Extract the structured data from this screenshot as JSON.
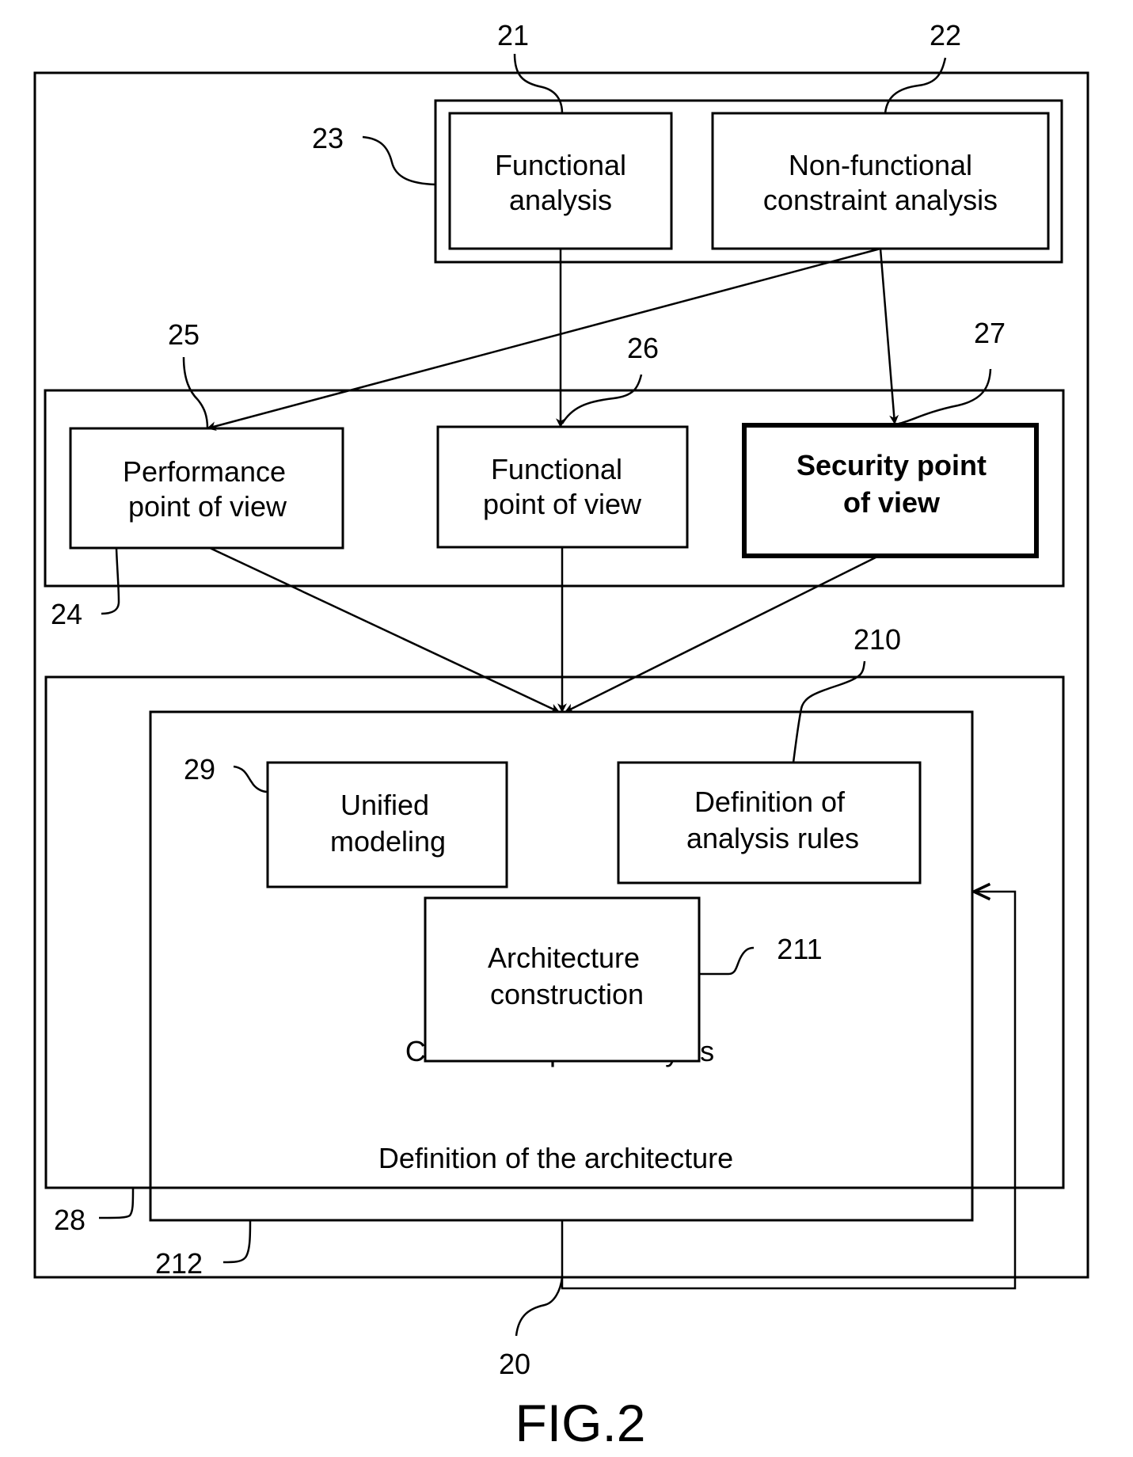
{
  "figure": {
    "caption": "FIG.2",
    "reference": "20"
  },
  "groups": {
    "analysis": {
      "ref": "23"
    },
    "points_of_view": {
      "ref": "24"
    },
    "architecture_definition": {
      "ref": "28",
      "label": "Definition of the architecture"
    },
    "crossed_impact": {
      "ref": "212",
      "label": "Crossed impact analysis"
    }
  },
  "boxes": {
    "functional_analysis": {
      "ref": "21",
      "lines": [
        "Functional",
        "analysis"
      ]
    },
    "nonfunctional_analysis": {
      "ref": "22",
      "lines": [
        "Non-functional",
        "constraint analysis"
      ]
    },
    "performance_pov": {
      "ref": "25",
      "lines": [
        "Performance",
        "point of view"
      ]
    },
    "functional_pov": {
      "ref": "26",
      "lines": [
        "Functional",
        "point of view"
      ]
    },
    "security_pov": {
      "ref": "27",
      "lines": [
        "Security point",
        "of view"
      ],
      "emphasis": "bold"
    },
    "unified_modeling": {
      "ref": "29",
      "lines": [
        "Unified",
        "modeling"
      ]
    },
    "analysis_rules": {
      "ref": "210",
      "lines": [
        "Definition of",
        "analysis rules"
      ]
    },
    "architecture_construction": {
      "ref": "211",
      "lines": [
        "Architecture",
        "construction"
      ]
    }
  }
}
